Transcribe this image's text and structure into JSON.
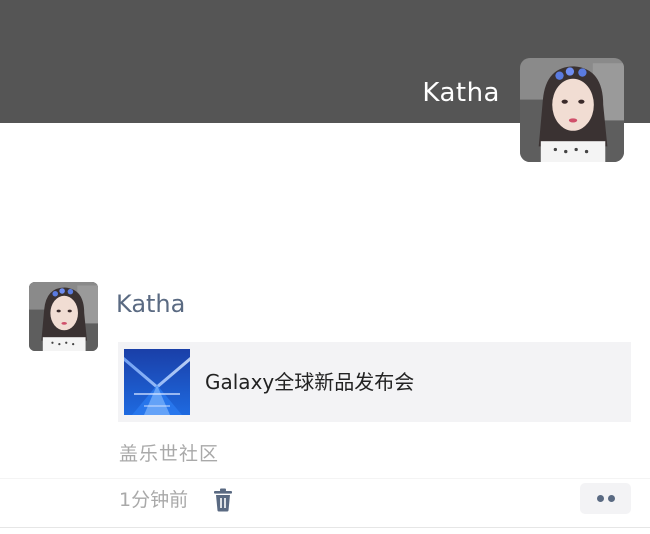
{
  "header": {
    "user_name": "Katha",
    "avatar_icon": "user-avatar",
    "background_color": "#555555"
  },
  "post": {
    "author_name": "Katha",
    "avatar_icon": "user-avatar",
    "link_card": {
      "title": "Galaxy全球新品发布会",
      "thumbnail_icon": "galaxy-event-thumbnail"
    },
    "source": "盖乐世社区",
    "time_ago": "1分钟前",
    "delete_icon": "trash-icon",
    "more_icon": "more-dots-icon"
  },
  "colors": {
    "name_link": "#5a6a82",
    "muted_text": "#a9a9a9",
    "card_bg": "#f3f3f5"
  }
}
